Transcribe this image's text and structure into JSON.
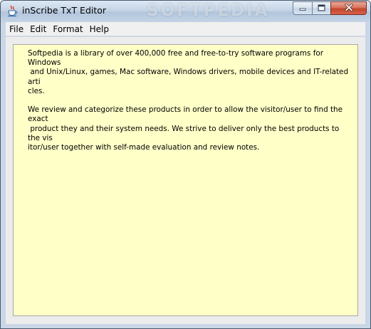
{
  "window": {
    "title": "inScribe TxT Editor",
    "watermark": "SOFTPEDIA"
  },
  "titlebar_icons": {
    "app": "java-cup-icon",
    "minimize": "minimize-icon",
    "maximize": "maximize-icon",
    "close": "close-icon"
  },
  "menu": {
    "file": "File",
    "edit": "Edit",
    "format": "Format",
    "help": "Help"
  },
  "editor": {
    "paragraph_1": "Softpedia is a library of over 400,000 free and free-to-try software programs for Windows\n and Unix/Linux, games, Mac software, Windows drivers, mobile devices and IT-related arti\ncles.",
    "paragraph_2": "We review and categorize these products in order to allow the visitor/user to find the exact\n product they and their system needs. We strive to deliver only the best products to the vis\nitor/user together with self-made evaluation and review notes."
  },
  "colors": {
    "editor_background": "#ffffc8",
    "close_button": "#c4452b",
    "titlebar": "#c4d4e6"
  }
}
